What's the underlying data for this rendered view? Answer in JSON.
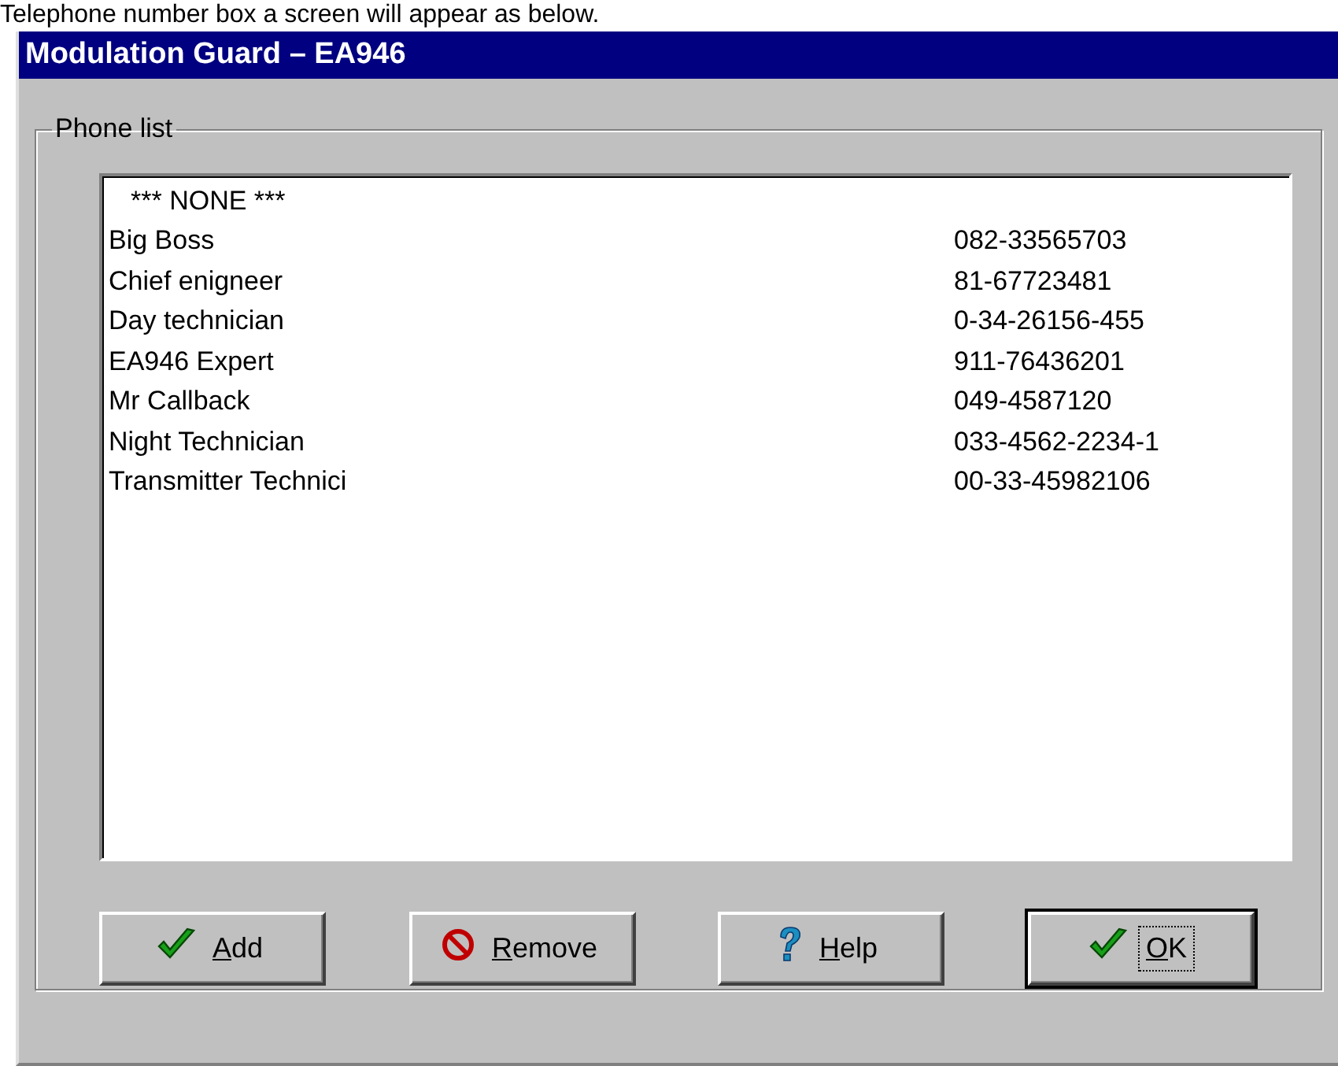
{
  "caption": "Telephone number box a screen will appear as below.",
  "window": {
    "title": "Modulation Guard – EA946"
  },
  "group": {
    "label": "Phone list"
  },
  "list": [
    {
      "kind": "placeholder",
      "name": "*** NONE ***"
    },
    {
      "kind": "entry",
      "name": "Big Boss",
      "number": "082-33565703"
    },
    {
      "kind": "entry",
      "name": "Chief enigneer",
      "number": "81-67723481"
    },
    {
      "kind": "entry",
      "name": "Day technician",
      "number": "0-34-26156-455"
    },
    {
      "kind": "entry",
      "name": "EA946 Expert",
      "number": "911-76436201"
    },
    {
      "kind": "entry",
      "name": "Mr Callback",
      "number": "049-4587120"
    },
    {
      "kind": "entry",
      "name": "Night Technician",
      "number": "033-4562-2234-1"
    },
    {
      "kind": "entry",
      "name": "Transmitter Technici",
      "number": "00-33-45982106"
    }
  ],
  "buttons": [
    {
      "kind": "accept",
      "key": "A",
      "rest": "dd",
      "default": false
    },
    {
      "kind": "remove",
      "key": "R",
      "rest": "emove",
      "default": false
    },
    {
      "kind": "help",
      "key": "H",
      "rest": "elp",
      "default": false
    },
    {
      "kind": "accept",
      "key": "O",
      "rest": "K",
      "default": true
    }
  ]
}
